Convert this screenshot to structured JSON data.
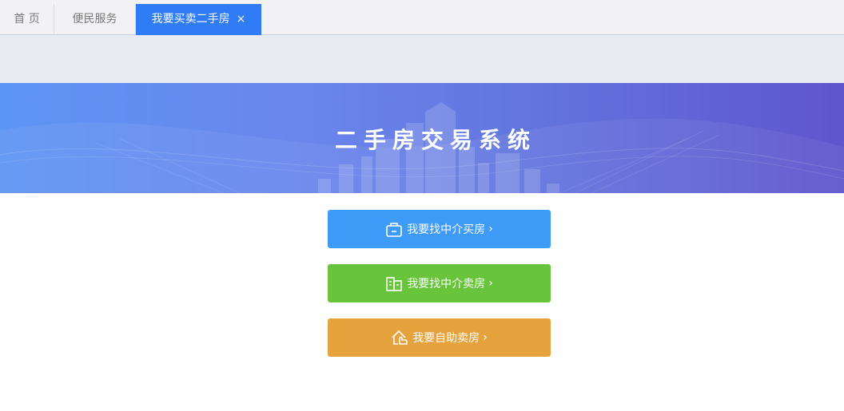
{
  "tabs": {
    "home_label": "首 页",
    "service_label": "便民服务",
    "active_label": "我要买卖二手房",
    "close_glyph": "×"
  },
  "banner": {
    "title": "二手房交易系统"
  },
  "actions": {
    "buy_via_agent": {
      "label": "我要找中介买房",
      "chevron": "›",
      "icon": "shopping-bag-icon",
      "color": "#3f9bf8"
    },
    "sell_via_agent": {
      "label": "我要找中介卖房",
      "chevron": "›",
      "icon": "building-icon",
      "color": "#68c43b"
    },
    "self_sell": {
      "label": "我要自助卖房",
      "chevron": "›",
      "icon": "house-hand-icon",
      "color": "#e6a33d"
    }
  },
  "colors": {
    "active_tab": "#2f7cf6",
    "banner_start": "#5d95f4",
    "banner_end": "#5f55cd"
  }
}
